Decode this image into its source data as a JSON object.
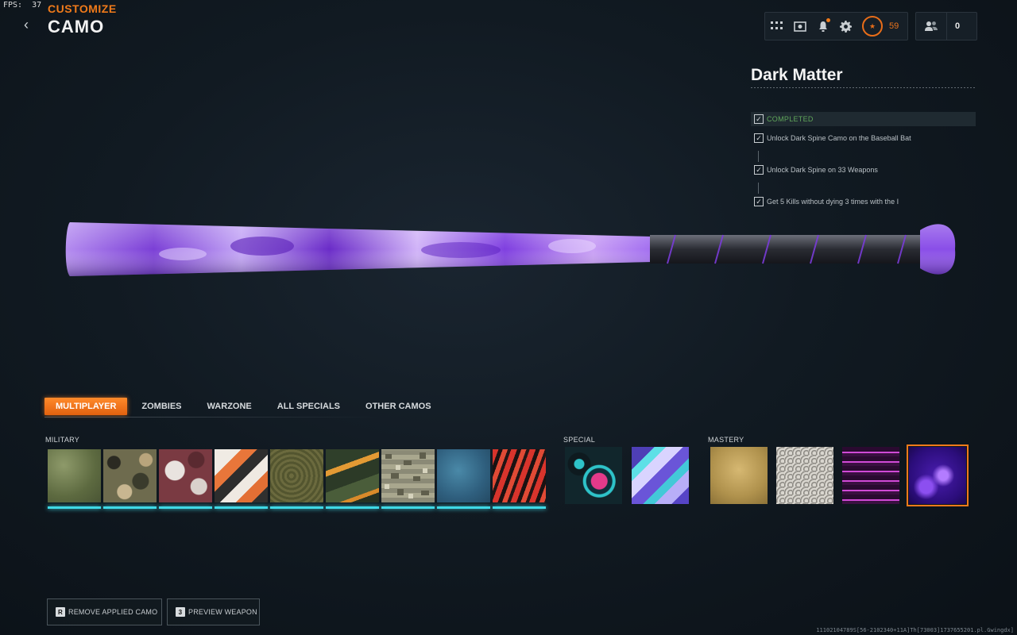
{
  "fps": {
    "label": "FPS:",
    "value": "37"
  },
  "header": {
    "subtitle": "CUSTOMIZE",
    "title": "CAMO"
  },
  "topbar": {
    "icons": [
      "grid-icon",
      "theater-icon",
      "bell-icon",
      "gear-icon"
    ],
    "level": "59",
    "friends_count": "0"
  },
  "camo": {
    "name": "Dark Matter",
    "status": "COMPLETED",
    "challenges": [
      "Unlock Dark Spine Camo on the Baseball Bat",
      "Unlock Dark Spine on 33 Weapons",
      "Get 5 Kills without dying 3 times with the I"
    ]
  },
  "tabs": [
    "MULTIPLAYER",
    "ZOMBIES",
    "WARZONE",
    "ALL SPECIALS",
    "OTHER CAMOS"
  ],
  "active_tab": "MULTIPLAYER",
  "sections": {
    "military": "MILITARY",
    "special": "SPECIAL",
    "mastery": "MASTERY"
  },
  "actions": {
    "remove": {
      "key": "R",
      "label": "REMOVE APPLIED CAMO"
    },
    "preview": {
      "key": "3",
      "label": "PREVIEW WEAPON"
    }
  },
  "footer_id": "11102104789S[56-2102340+11A]Th[73003]1737655201.pl.Gwingdx]",
  "colors": {
    "accent": "#f07a1a",
    "progress": "#3fd9e6",
    "completed": "#5fa65a"
  }
}
